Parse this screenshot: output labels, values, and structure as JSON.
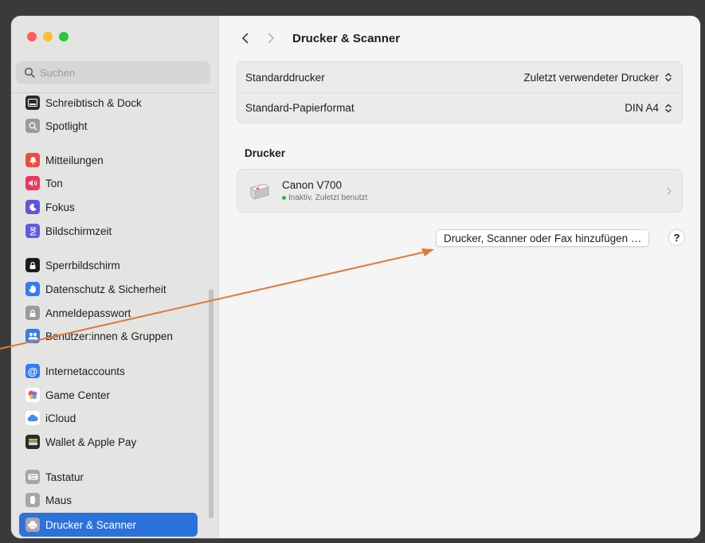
{
  "colors": {
    "accent": "#2c72dd",
    "annotation_arrow": "#e3773a"
  },
  "search": {
    "placeholder": "Suchen"
  },
  "sidebar": {
    "items": [
      {
        "label": "Schreibtisch & Dock",
        "icon": "dock-icon",
        "color": "#1d1d1f"
      },
      {
        "label": "Spotlight",
        "icon": "spotlight-icon",
        "color": "#8e8e93"
      },
      {
        "label": "Mitteilungen",
        "icon": "notifications-icon",
        "color": "#ff3b30"
      },
      {
        "label": "Ton",
        "icon": "sound-icon",
        "color": "#ff2d55"
      },
      {
        "label": "Fokus",
        "icon": "focus-icon",
        "color": "#5856d6"
      },
      {
        "label": "Bildschirmzeit",
        "icon": "screentime-icon",
        "color": "#5e5ce6"
      },
      {
        "label": "Sperrbildschirm",
        "icon": "lockscreen-icon",
        "color": "#1d1d1f"
      },
      {
        "label": "Datenschutz & Sicherheit",
        "icon": "privacy-hand-icon",
        "color": "#2f7cf6"
      },
      {
        "label": "Anmeldepasswort",
        "icon": "lock-icon",
        "color": "#8e8e93"
      },
      {
        "label": "Benutzer:innen & Gruppen",
        "icon": "users-icon",
        "color": "#2f7cf6"
      },
      {
        "label": "Internetaccounts",
        "icon": "at-icon",
        "color": "#2f7cf6"
      },
      {
        "label": "Game Center",
        "icon": "gamecenter-icon",
        "color": "#ffffff"
      },
      {
        "label": "iCloud",
        "icon": "cloud-icon",
        "color": "#ffffff"
      },
      {
        "label": "Wallet & Apple Pay",
        "icon": "wallet-icon",
        "color": "#1d1d1f"
      },
      {
        "label": "Tastatur",
        "icon": "keyboard-icon",
        "color": "#8e8e93"
      },
      {
        "label": "Maus",
        "icon": "mouse-icon",
        "color": "#8e8e93"
      },
      {
        "label": "Drucker & Scanner",
        "icon": "printer-icon",
        "color": "#8e8e93",
        "selected": true
      }
    ]
  },
  "main": {
    "title": "Drucker & Scanner",
    "settings": {
      "default_printer_label": "Standarddrucker",
      "default_printer_value": "Zuletzt verwendeter Drucker",
      "paper_size_label": "Standard-Papierformat",
      "paper_size_value": "DIN A4"
    },
    "printers_section_title": "Drucker",
    "printers": [
      {
        "name": "Canon V700",
        "status": "Inaktiv, Zuletzt benutzt"
      }
    ],
    "add_button_label": "Drucker, Scanner oder Fax hinzufügen …",
    "help_button_label": "?"
  }
}
